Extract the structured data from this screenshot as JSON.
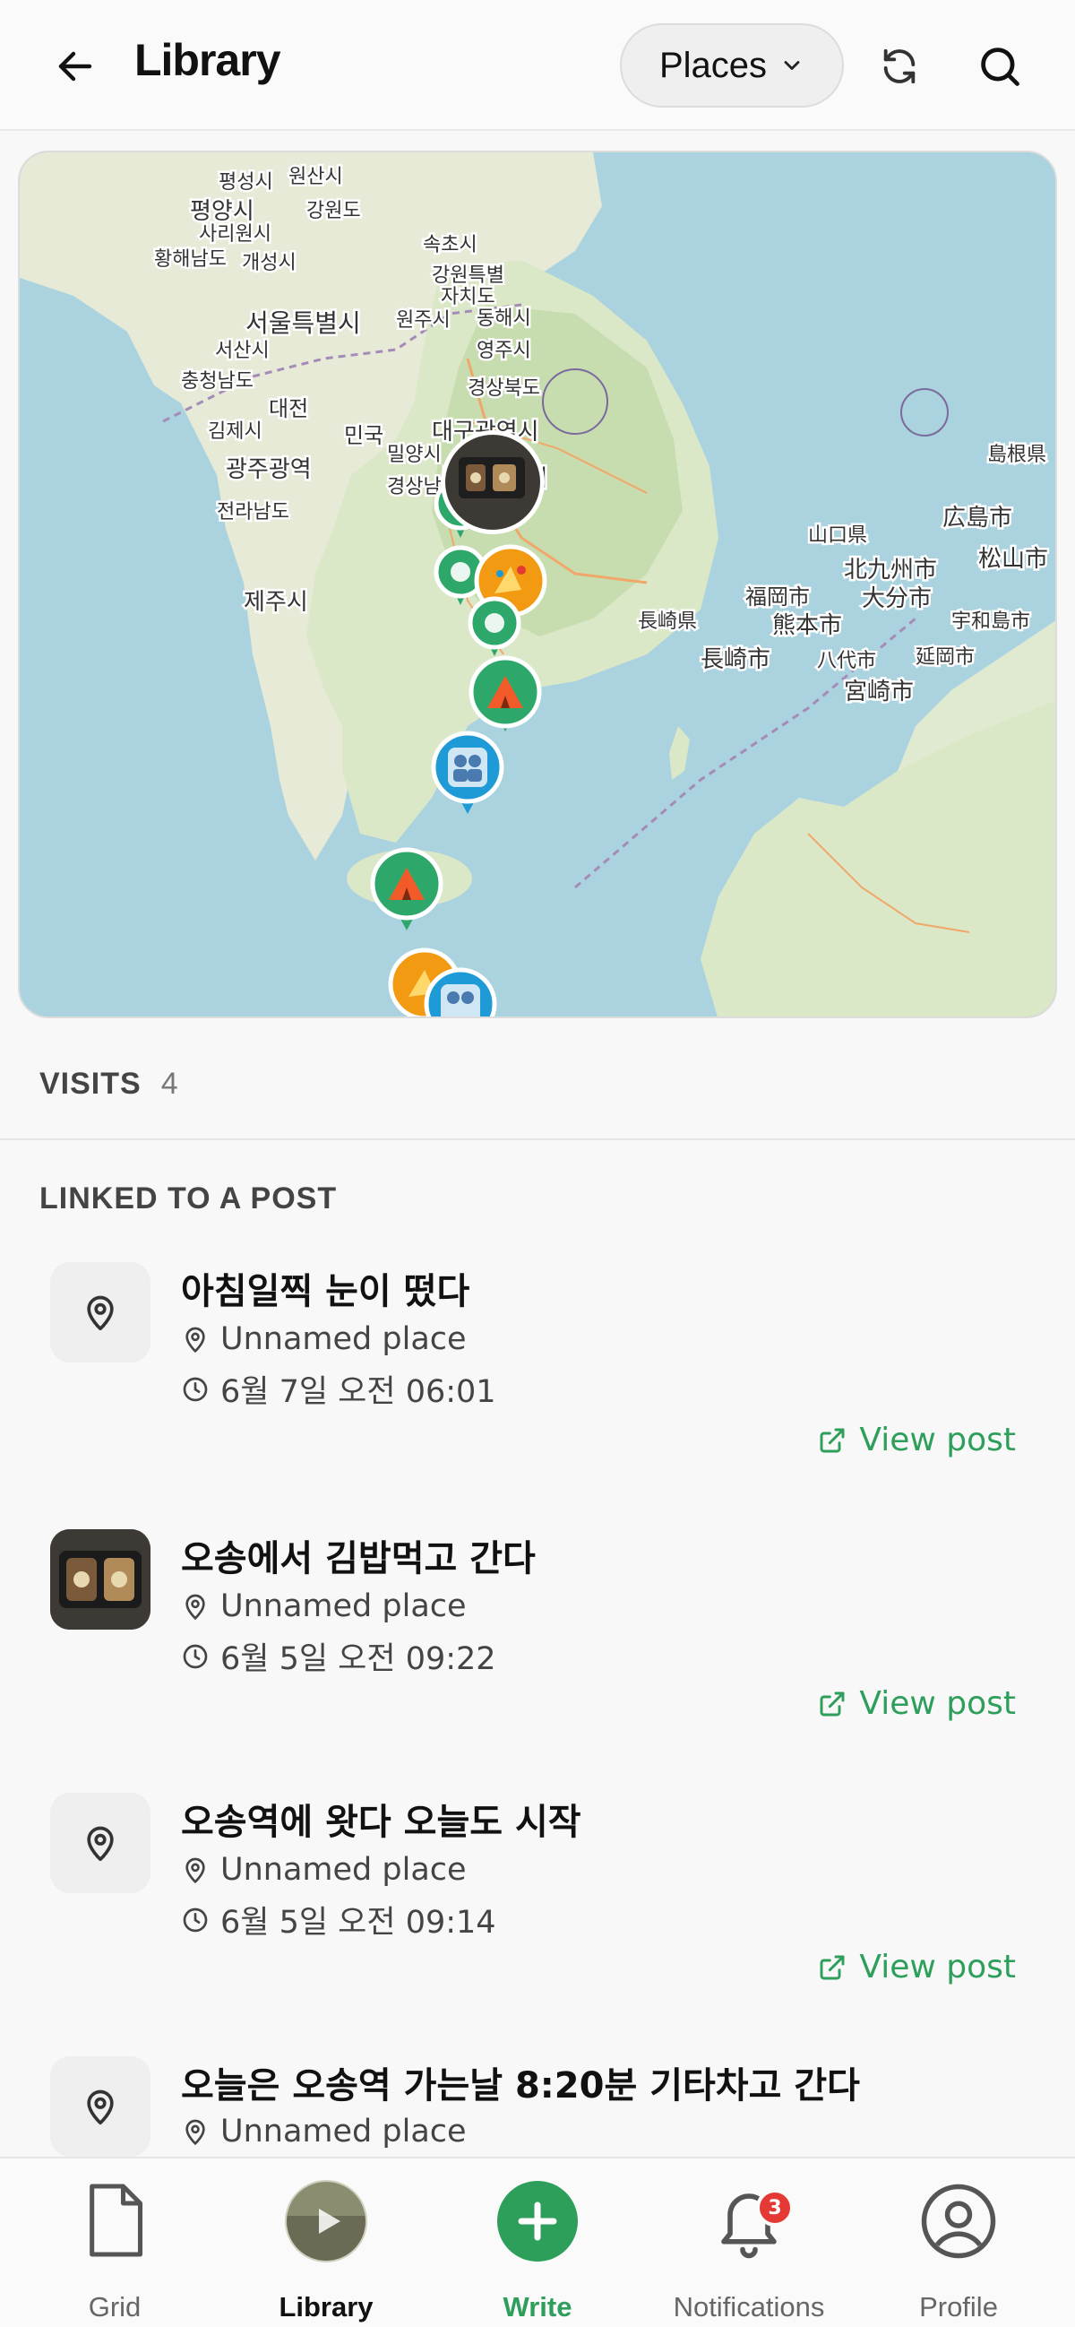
{
  "header": {
    "title": "Library",
    "filter_label": "Places"
  },
  "map": {
    "labels": [
      {
        "text": "평성시"
      },
      {
        "text": "원산시"
      },
      {
        "text": "평양시"
      },
      {
        "text": "강원도"
      },
      {
        "text": "사리원시"
      },
      {
        "text": "황해남도"
      },
      {
        "text": "개성시"
      },
      {
        "text": "속초시"
      },
      {
        "text": "강원특별"
      },
      {
        "text": "자치도"
      },
      {
        "text": "서울특별시"
      },
      {
        "text": "원주시"
      },
      {
        "text": "동해시"
      },
      {
        "text": "서산시"
      },
      {
        "text": "영주시"
      },
      {
        "text": "충청남도"
      },
      {
        "text": "경상북도"
      },
      {
        "text": "대전"
      },
      {
        "text": "김제시"
      },
      {
        "text": "대구광역시"
      },
      {
        "text": "민국"
      },
      {
        "text": "밀양시"
      },
      {
        "text": "광주광역"
      },
      {
        "text": "부산광역시"
      },
      {
        "text": "경상남도"
      },
      {
        "text": "전라남도"
      },
      {
        "text": "제주시"
      },
      {
        "text": "島根県"
      },
      {
        "text": "広島市"
      },
      {
        "text": "山口県"
      },
      {
        "text": "北九州市"
      },
      {
        "text": "松山市"
      },
      {
        "text": "福岡市"
      },
      {
        "text": "大分市"
      },
      {
        "text": "長崎県"
      },
      {
        "text": "熊本市"
      },
      {
        "text": "宇和島市"
      },
      {
        "text": "長崎市"
      },
      {
        "text": "八代市"
      },
      {
        "text": "延岡市"
      },
      {
        "text": "宮崎市"
      }
    ]
  },
  "visits": {
    "label": "VISITS",
    "count": "4"
  },
  "section_title": "LINKED TO A POST",
  "items": [
    {
      "title": "아침일찍 눈이 떴다",
      "place": "Unnamed place",
      "time": "6월 7일 오전 06:01",
      "action": "View post"
    },
    {
      "title": "오송에서 김밥먹고 간다",
      "place": "Unnamed place",
      "time": "6월 5일 오전 09:22",
      "action": "View post"
    },
    {
      "title": "오송역에 왓다 오늘도 시작",
      "place": "Unnamed place",
      "time": "6월 5일 오전 09:14",
      "action": "View post"
    },
    {
      "title": "오늘은 오송역 가는날 8:20분 기타차고 간다",
      "place": "Unnamed place",
      "time": "",
      "action": ""
    }
  ],
  "tabbar": {
    "grid": "Grid",
    "library": "Library",
    "write": "Write",
    "notifications": "Notifications",
    "notifications_badge": "3",
    "profile": "Profile"
  },
  "colors": {
    "accent": "#2e9e5b",
    "badge": "#e53935",
    "marker_green": "#2ea86a",
    "marker_orange": "#f29a12",
    "marker_blue": "#1e9bd7"
  }
}
